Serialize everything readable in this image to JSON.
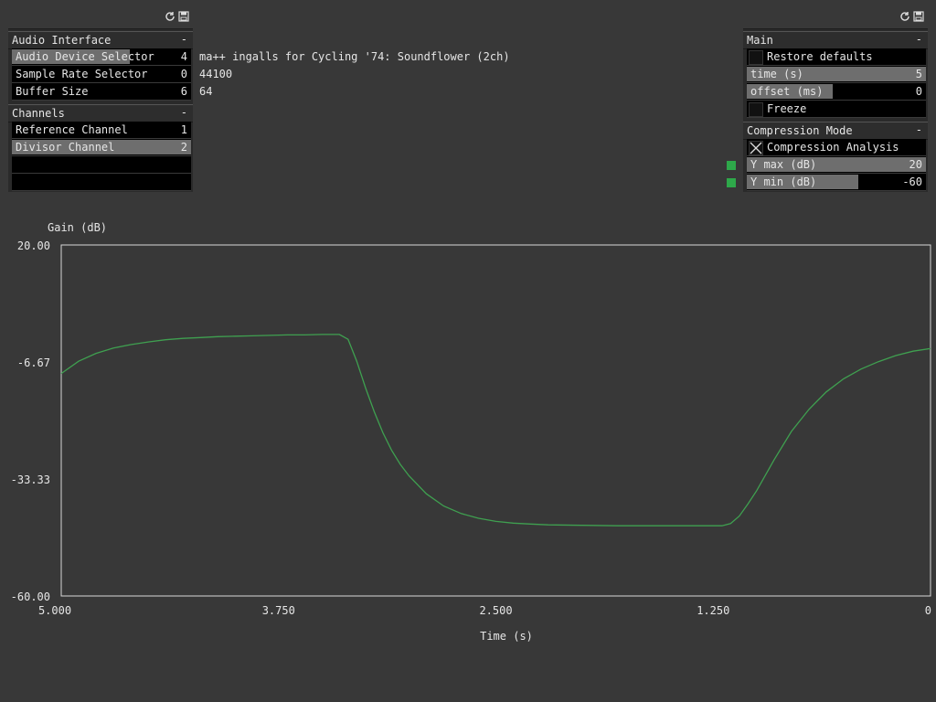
{
  "left_panel": {
    "audio_interface": {
      "title": "Audio Interface",
      "collapse": "-",
      "rows": [
        {
          "label": "Audio Device Selector",
          "value": "4",
          "fill": 0.66,
          "info": "ma++ ingalls for Cycling '74: Soundflower (2ch)"
        },
        {
          "label": "Sample Rate Selector",
          "value": "0",
          "fill": 0.0,
          "info": "44100"
        },
        {
          "label": "Buffer Size",
          "value": "6",
          "fill": 0.0,
          "info": "64"
        }
      ]
    },
    "channels": {
      "title": "Channels",
      "collapse": "-",
      "rows": [
        {
          "label": "Reference Channel",
          "value": "1",
          "fill": 0.0
        },
        {
          "label": "Divisor Channel",
          "value": "2",
          "fill": 1.0
        }
      ]
    }
  },
  "right_panel": {
    "main": {
      "title": "Main",
      "collapse": "-",
      "restore_defaults": {
        "label": "Restore defaults",
        "checked": false
      },
      "time": {
        "label": "time (s)",
        "value": "5",
        "fill": 1.0
      },
      "offset": {
        "label": "offset (ms)",
        "value": "0",
        "fill": 0.48
      },
      "freeze": {
        "label": "Freeze",
        "checked": false
      }
    },
    "compression_mode": {
      "title": "Compression Mode",
      "collapse": "-",
      "compression_analysis": {
        "label": "Compression Analysis",
        "checked": true
      },
      "y_max": {
        "label": "Y max (dB)",
        "value": "20",
        "fill": 1.0
      },
      "y_min": {
        "label": "Y min (dB)",
        "value": "-60",
        "fill": 0.62
      }
    }
  },
  "colors": {
    "accent_green": "#2ea84a",
    "curve_green": "#3fa050",
    "slider_fill": "#6e6e6e"
  },
  "chart_data": {
    "type": "line",
    "title": "",
    "ylabel": "Gain (dB)",
    "xlabel": "Time (s)",
    "xlim": [
      5.0,
      0.0
    ],
    "ylim": [
      -60.0,
      20.0
    ],
    "x_ticks": [
      "5.000",
      "3.750",
      "2.500",
      "1.250",
      "0"
    ],
    "y_ticks": [
      "20.00",
      "-6.67",
      "-33.33",
      "-60.00"
    ],
    "grid": false,
    "series": [
      {
        "x": [
          5.0,
          4.9,
          4.8,
          4.7,
          4.6,
          4.5,
          4.4,
          4.3,
          4.2,
          4.1,
          4.0,
          3.9,
          3.8,
          3.7,
          3.6,
          3.5,
          3.4,
          3.35,
          3.3,
          3.25,
          3.2,
          3.15,
          3.1,
          3.05,
          3.0,
          2.9,
          2.8,
          2.7,
          2.6,
          2.5,
          2.4,
          2.3,
          2.2,
          2.0,
          1.8,
          1.6,
          1.4,
          1.2,
          1.15,
          1.1,
          1.05,
          1.0,
          0.9,
          0.8,
          0.7,
          0.6,
          0.5,
          0.4,
          0.3,
          0.2,
          0.1,
          0.0
        ],
        "y": [
          -9.3,
          -6.5,
          -4.7,
          -3.5,
          -2.7,
          -2.1,
          -1.6,
          -1.3,
          -1.1,
          -0.9,
          -0.8,
          -0.7,
          -0.6,
          -0.5,
          -0.5,
          -0.4,
          -0.4,
          -1.5,
          -6.5,
          -12.5,
          -18.0,
          -22.8,
          -26.8,
          -30.0,
          -32.6,
          -36.7,
          -39.5,
          -41.2,
          -42.3,
          -43.0,
          -43.4,
          -43.6,
          -43.8,
          -43.9,
          -44.0,
          -44.0,
          -44.0,
          -44.0,
          -43.5,
          -41.8,
          -39.0,
          -36.0,
          -29.0,
          -22.5,
          -17.5,
          -13.5,
          -10.5,
          -8.3,
          -6.6,
          -5.2,
          -4.2,
          -3.6
        ]
      }
    ]
  }
}
